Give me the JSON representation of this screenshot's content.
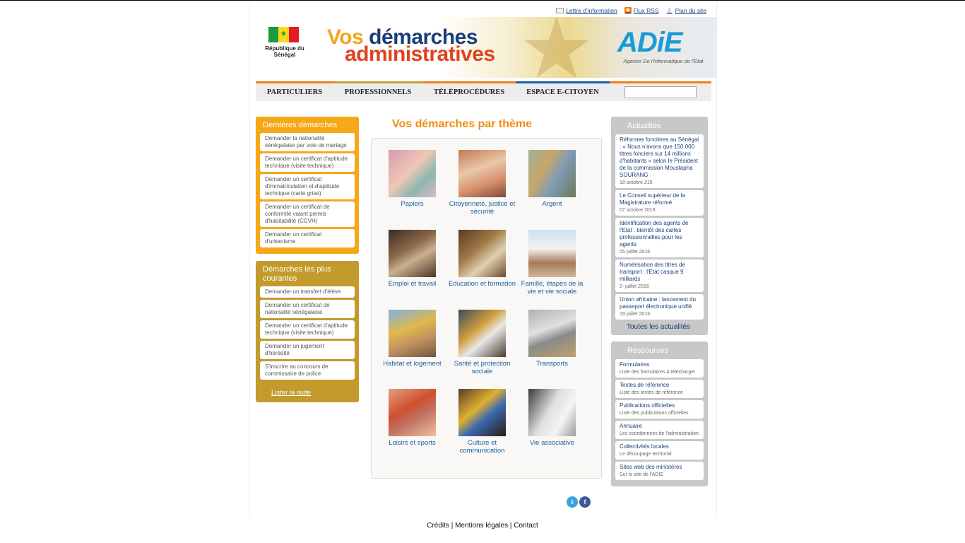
{
  "toplinks": [
    {
      "label": "Lettre d'information",
      "icon": "mail-icon"
    },
    {
      "label": "Flux RSS",
      "icon": "rss-icon"
    },
    {
      "label": "Plan du site",
      "icon": "sitemap-icon"
    }
  ],
  "banner": {
    "country": "République du Sénégal",
    "title_part1": "Vos",
    "title_part2": " démarches",
    "title_line2": "administratives",
    "agency": "ADiE",
    "agency_full": "Agence De l'Informatique de l'Etat"
  },
  "nav": [
    "PARTICULIERS",
    "PROFESSIONNELS",
    "TÉLÉPROCÉDURES",
    "ESPACE E-CITOYEN"
  ],
  "search": {
    "placeholder": ""
  },
  "left": {
    "recent": {
      "title": "Dernières démarches",
      "items": [
        "Demander la nationalité sénégalaise par voie de mariage",
        "Demander un certificat d'aptitude technique (visite technique)",
        "Demander un certificat d'immatriculation et d'aptitude technique (carte grise)",
        "Demander un certificat de conformité valant permis d'habitabilité (CCVH)",
        "Demander un certificat d'urbanisme"
      ]
    },
    "common": {
      "title": "Démarches les plus courantes",
      "items": [
        "Demander un transfert d'élève",
        "Demander un certificat de nationalité sénégalaise",
        "Demander un certificat d'aptitude technique (visite technique)",
        "Demander un jugement d'hérédité",
        "S'inscrire au concours de commissaire de police"
      ],
      "more": "Lister la suite"
    }
  },
  "center": {
    "title": "Vos démarches par thème",
    "themes": [
      "Papiers",
      "Citoyenneté, justice et sécurité",
      "Argent",
      "Emploi et travail",
      "Education et formation",
      "Famille, étapes de la vie et vie sociale",
      "Habitat et logement",
      "Santé et protection sociale",
      "Transports",
      "Loisirs et sports",
      "Culture et communication",
      "Vie associative"
    ]
  },
  "right": {
    "news": {
      "title": "Actualités",
      "items": [
        {
          "t": "Réformes foncières au Sénégal : « Nous n'avons que 150.000 titres fonciers sur 14 millions d'habitants » selon le Président de la commission Moustapha SOURANG",
          "d": "18 octobre 216"
        },
        {
          "t": "Le Conseil supérieur de la Magistrature réformé",
          "d": "07 octobre 2016"
        },
        {
          "t": "Identification des agents de l'Etat : bientôt des cartes professionnelles pour les agents",
          "d": "05 juillet 2016"
        },
        {
          "t": "Numérisation des titres de transport : l'Etat casque 9 milliards",
          "d": "2- juillet 2016"
        },
        {
          "t": "Union africaine : lancement du passeport électronique unifié",
          "d": "19 juillet 2016"
        }
      ],
      "all": "Toutes les actualités"
    },
    "resources": {
      "title": "Ressources",
      "items": [
        {
          "t": "Formulaires",
          "d": "Liste des formulaires à télécharger"
        },
        {
          "t": "Textes de référence",
          "d": "Liste des textes de référence"
        },
        {
          "t": "Publications officielles",
          "d": "Liste des publications officielles"
        },
        {
          "t": "Annuaire",
          "d": "Les coordonnées de l'administration"
        },
        {
          "t": "Collectivités locales",
          "d": "Le découpage territorial"
        },
        {
          "t": "Sites web des ministères",
          "d": "Sur le site de l'ADIE"
        }
      ]
    }
  },
  "social": [
    "twitter-icon",
    "facebook-icon"
  ],
  "footer": [
    "Crédits",
    "Mentions légales",
    "Contact"
  ],
  "colors": {
    "orange": "#f7a816",
    "gold": "#c29b2c",
    "blue": "#1a5fa0",
    "grey": "#c8c8c8"
  }
}
